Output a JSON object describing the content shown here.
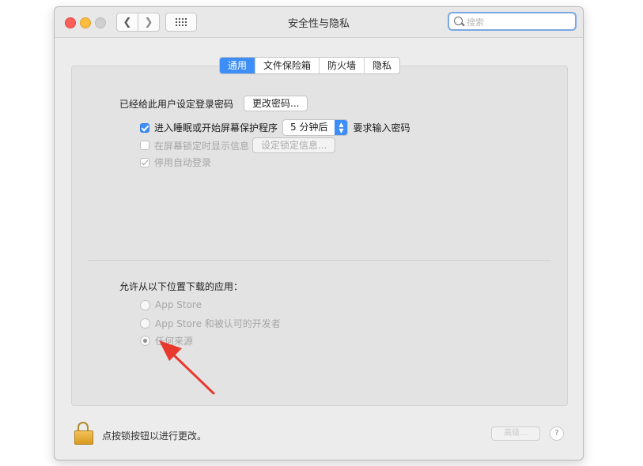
{
  "window": {
    "title": "安全性与隐私",
    "search_placeholder": "搜索"
  },
  "tabs": [
    {
      "label": "通用",
      "active": true
    },
    {
      "label": "文件保险箱",
      "active": false
    },
    {
      "label": "防火墙",
      "active": false
    },
    {
      "label": "隐私",
      "active": false
    }
  ],
  "general": {
    "password_set_label": "已经给此用户设定登录密码",
    "change_password_button": "更改密码...",
    "require_password_label": "进入睡眠或开始屏幕保护程序",
    "require_password_checked": true,
    "require_password_delay": "5 分钟后",
    "require_password_suffix": "要求输入密码",
    "show_message_label": "在屏幕锁定时显示信息",
    "show_message_checked": false,
    "set_lock_message_button": "设定锁定信息...",
    "disable_auto_login_label": "停用自动登录",
    "disable_auto_login_checked": true
  },
  "downloads": {
    "heading": "允许从以下位置下载的应用：",
    "options": [
      {
        "label": "App Store",
        "selected": false
      },
      {
        "label": "App Store 和被认可的开发者",
        "selected": false
      },
      {
        "label": "任何来源",
        "selected": true
      }
    ]
  },
  "footer": {
    "lock_text": "点按锁按钮以进行更改。",
    "advanced_button": "高级...",
    "help_button": "?"
  },
  "colors": {
    "accent": "#3d8ef7",
    "arrow": "#e8392f"
  }
}
